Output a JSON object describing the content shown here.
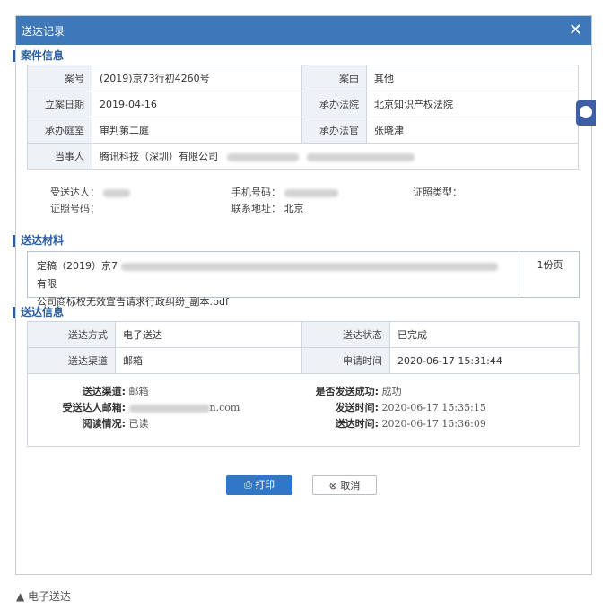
{
  "dialog": {
    "title": "送达记录",
    "close_glyph": "✕"
  },
  "case_section": {
    "title": "案件信息",
    "rows": [
      {
        "l1": "案号",
        "v1": "(2019)京73行初4260号",
        "l2": "案由",
        "v2": "其他"
      },
      {
        "l1": "立案日期",
        "v1": "2019-04-16",
        "l2": "承办法院",
        "v2": "北京知识产权法院"
      },
      {
        "l1": "承办庭室",
        "v1": "审判第二庭",
        "l2": "承办法官",
        "v2": "张晓津"
      }
    ],
    "party_label": "当事人",
    "party_value": "腾讯科技（深圳）有限公司"
  },
  "recipient": {
    "receiver_label": "受送达人：",
    "phone_label": "手机号码：",
    "id_type_label": "证照类型：",
    "id_no_label": "证照号码：",
    "address_label": "联系地址：",
    "address_value": "北京"
  },
  "material_section": {
    "title": "送达材料",
    "line1_prefix": "定稿（2019）京7",
    "line1_suffix": "有限",
    "line2": "公司商标权无效宣告请求行政纠纷_副本.pdf",
    "pages": "1份页"
  },
  "send_section": {
    "title": "送达信息",
    "rows": [
      {
        "l1": "送达方式",
        "v1": "电子送达",
        "l2": "送达状态",
        "v2": "已完成"
      },
      {
        "l1": "送达渠道",
        "v1": "邮箱",
        "l2": "申请时间",
        "v2": "2020-06-17 15:31:44"
      }
    ],
    "detail": {
      "channel_label": "送达渠道:",
      "channel_value": "邮箱",
      "email_label": "受送达人邮箱:",
      "email_suffix": "n.com",
      "read_label": "阅读情况:",
      "read_value": "已读",
      "success_label": "是否发送成功:",
      "success_value": "成功",
      "sent_label": "发送时间:",
      "sent_value": "2020-06-17 15:35:15",
      "read_time_label": "送达时间:",
      "read_time_value": "2020-06-17 15:36:09"
    }
  },
  "buttons": {
    "print": "打印",
    "cancel": "取消"
  },
  "caption": "▲ 电子送达",
  "colors": {
    "titlebar": "#3e78b8",
    "section": "#2c5e9e",
    "primary_button": "#2f78c9"
  }
}
